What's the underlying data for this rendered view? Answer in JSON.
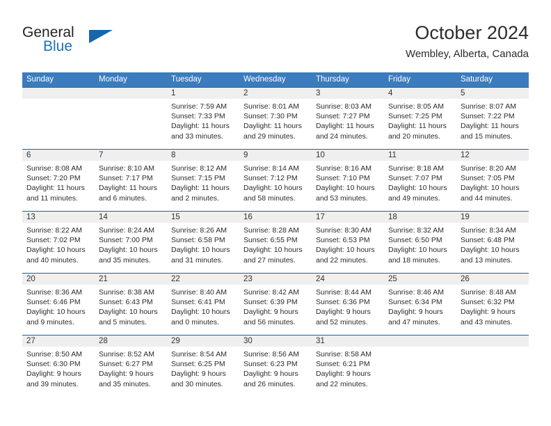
{
  "logo": {
    "primary_text": "General",
    "secondary_text": "Blue",
    "primary_color": "#222222",
    "secondary_color": "#1b72bd",
    "triangle_color": "#1566ad"
  },
  "header": {
    "title": "October 2024",
    "subtitle": "Wembley, Alberta, Canada"
  },
  "theme": {
    "header_row_bg": "#3a7cbe",
    "header_row_text": "#ffffff",
    "week_divider": "#1f5fa0",
    "day_strip_bg": "#efefef",
    "cell_text": "#2b2b2b"
  },
  "weekdays": [
    "Sunday",
    "Monday",
    "Tuesday",
    "Wednesday",
    "Thursday",
    "Friday",
    "Saturday"
  ],
  "weeks": [
    [
      {
        "day": "",
        "sunrise": "",
        "sunset": "",
        "daylight_line1": "",
        "daylight_line2": ""
      },
      {
        "day": "",
        "sunrise": "",
        "sunset": "",
        "daylight_line1": "",
        "daylight_line2": ""
      },
      {
        "day": "1",
        "sunrise": "Sunrise: 7:59 AM",
        "sunset": "Sunset: 7:33 PM",
        "daylight_line1": "Daylight: 11 hours",
        "daylight_line2": "and 33 minutes."
      },
      {
        "day": "2",
        "sunrise": "Sunrise: 8:01 AM",
        "sunset": "Sunset: 7:30 PM",
        "daylight_line1": "Daylight: 11 hours",
        "daylight_line2": "and 29 minutes."
      },
      {
        "day": "3",
        "sunrise": "Sunrise: 8:03 AM",
        "sunset": "Sunset: 7:27 PM",
        "daylight_line1": "Daylight: 11 hours",
        "daylight_line2": "and 24 minutes."
      },
      {
        "day": "4",
        "sunrise": "Sunrise: 8:05 AM",
        "sunset": "Sunset: 7:25 PM",
        "daylight_line1": "Daylight: 11 hours",
        "daylight_line2": "and 20 minutes."
      },
      {
        "day": "5",
        "sunrise": "Sunrise: 8:07 AM",
        "sunset": "Sunset: 7:22 PM",
        "daylight_line1": "Daylight: 11 hours",
        "daylight_line2": "and 15 minutes."
      }
    ],
    [
      {
        "day": "6",
        "sunrise": "Sunrise: 8:08 AM",
        "sunset": "Sunset: 7:20 PM",
        "daylight_line1": "Daylight: 11 hours",
        "daylight_line2": "and 11 minutes."
      },
      {
        "day": "7",
        "sunrise": "Sunrise: 8:10 AM",
        "sunset": "Sunset: 7:17 PM",
        "daylight_line1": "Daylight: 11 hours",
        "daylight_line2": "and 6 minutes."
      },
      {
        "day": "8",
        "sunrise": "Sunrise: 8:12 AM",
        "sunset": "Sunset: 7:15 PM",
        "daylight_line1": "Daylight: 11 hours",
        "daylight_line2": "and 2 minutes."
      },
      {
        "day": "9",
        "sunrise": "Sunrise: 8:14 AM",
        "sunset": "Sunset: 7:12 PM",
        "daylight_line1": "Daylight: 10 hours",
        "daylight_line2": "and 58 minutes."
      },
      {
        "day": "10",
        "sunrise": "Sunrise: 8:16 AM",
        "sunset": "Sunset: 7:10 PM",
        "daylight_line1": "Daylight: 10 hours",
        "daylight_line2": "and 53 minutes."
      },
      {
        "day": "11",
        "sunrise": "Sunrise: 8:18 AM",
        "sunset": "Sunset: 7:07 PM",
        "daylight_line1": "Daylight: 10 hours",
        "daylight_line2": "and 49 minutes."
      },
      {
        "day": "12",
        "sunrise": "Sunrise: 8:20 AM",
        "sunset": "Sunset: 7:05 PM",
        "daylight_line1": "Daylight: 10 hours",
        "daylight_line2": "and 44 minutes."
      }
    ],
    [
      {
        "day": "13",
        "sunrise": "Sunrise: 8:22 AM",
        "sunset": "Sunset: 7:02 PM",
        "daylight_line1": "Daylight: 10 hours",
        "daylight_line2": "and 40 minutes."
      },
      {
        "day": "14",
        "sunrise": "Sunrise: 8:24 AM",
        "sunset": "Sunset: 7:00 PM",
        "daylight_line1": "Daylight: 10 hours",
        "daylight_line2": "and 35 minutes."
      },
      {
        "day": "15",
        "sunrise": "Sunrise: 8:26 AM",
        "sunset": "Sunset: 6:58 PM",
        "daylight_line1": "Daylight: 10 hours",
        "daylight_line2": "and 31 minutes."
      },
      {
        "day": "16",
        "sunrise": "Sunrise: 8:28 AM",
        "sunset": "Sunset: 6:55 PM",
        "daylight_line1": "Daylight: 10 hours",
        "daylight_line2": "and 27 minutes."
      },
      {
        "day": "17",
        "sunrise": "Sunrise: 8:30 AM",
        "sunset": "Sunset: 6:53 PM",
        "daylight_line1": "Daylight: 10 hours",
        "daylight_line2": "and 22 minutes."
      },
      {
        "day": "18",
        "sunrise": "Sunrise: 8:32 AM",
        "sunset": "Sunset: 6:50 PM",
        "daylight_line1": "Daylight: 10 hours",
        "daylight_line2": "and 18 minutes."
      },
      {
        "day": "19",
        "sunrise": "Sunrise: 8:34 AM",
        "sunset": "Sunset: 6:48 PM",
        "daylight_line1": "Daylight: 10 hours",
        "daylight_line2": "and 13 minutes."
      }
    ],
    [
      {
        "day": "20",
        "sunrise": "Sunrise: 8:36 AM",
        "sunset": "Sunset: 6:46 PM",
        "daylight_line1": "Daylight: 10 hours",
        "daylight_line2": "and 9 minutes."
      },
      {
        "day": "21",
        "sunrise": "Sunrise: 8:38 AM",
        "sunset": "Sunset: 6:43 PM",
        "daylight_line1": "Daylight: 10 hours",
        "daylight_line2": "and 5 minutes."
      },
      {
        "day": "22",
        "sunrise": "Sunrise: 8:40 AM",
        "sunset": "Sunset: 6:41 PM",
        "daylight_line1": "Daylight: 10 hours",
        "daylight_line2": "and 0 minutes."
      },
      {
        "day": "23",
        "sunrise": "Sunrise: 8:42 AM",
        "sunset": "Sunset: 6:39 PM",
        "daylight_line1": "Daylight: 9 hours",
        "daylight_line2": "and 56 minutes."
      },
      {
        "day": "24",
        "sunrise": "Sunrise: 8:44 AM",
        "sunset": "Sunset: 6:36 PM",
        "daylight_line1": "Daylight: 9 hours",
        "daylight_line2": "and 52 minutes."
      },
      {
        "day": "25",
        "sunrise": "Sunrise: 8:46 AM",
        "sunset": "Sunset: 6:34 PM",
        "daylight_line1": "Daylight: 9 hours",
        "daylight_line2": "and 47 minutes."
      },
      {
        "day": "26",
        "sunrise": "Sunrise: 8:48 AM",
        "sunset": "Sunset: 6:32 PM",
        "daylight_line1": "Daylight: 9 hours",
        "daylight_line2": "and 43 minutes."
      }
    ],
    [
      {
        "day": "27",
        "sunrise": "Sunrise: 8:50 AM",
        "sunset": "Sunset: 6:30 PM",
        "daylight_line1": "Daylight: 9 hours",
        "daylight_line2": "and 39 minutes."
      },
      {
        "day": "28",
        "sunrise": "Sunrise: 8:52 AM",
        "sunset": "Sunset: 6:27 PM",
        "daylight_line1": "Daylight: 9 hours",
        "daylight_line2": "and 35 minutes."
      },
      {
        "day": "29",
        "sunrise": "Sunrise: 8:54 AM",
        "sunset": "Sunset: 6:25 PM",
        "daylight_line1": "Daylight: 9 hours",
        "daylight_line2": "and 30 minutes."
      },
      {
        "day": "30",
        "sunrise": "Sunrise: 8:56 AM",
        "sunset": "Sunset: 6:23 PM",
        "daylight_line1": "Daylight: 9 hours",
        "daylight_line2": "and 26 minutes."
      },
      {
        "day": "31",
        "sunrise": "Sunrise: 8:58 AM",
        "sunset": "Sunset: 6:21 PM",
        "daylight_line1": "Daylight: 9 hours",
        "daylight_line2": "and 22 minutes."
      },
      {
        "day": "",
        "sunrise": "",
        "sunset": "",
        "daylight_line1": "",
        "daylight_line2": ""
      },
      {
        "day": "",
        "sunrise": "",
        "sunset": "",
        "daylight_line1": "",
        "daylight_line2": ""
      }
    ]
  ]
}
